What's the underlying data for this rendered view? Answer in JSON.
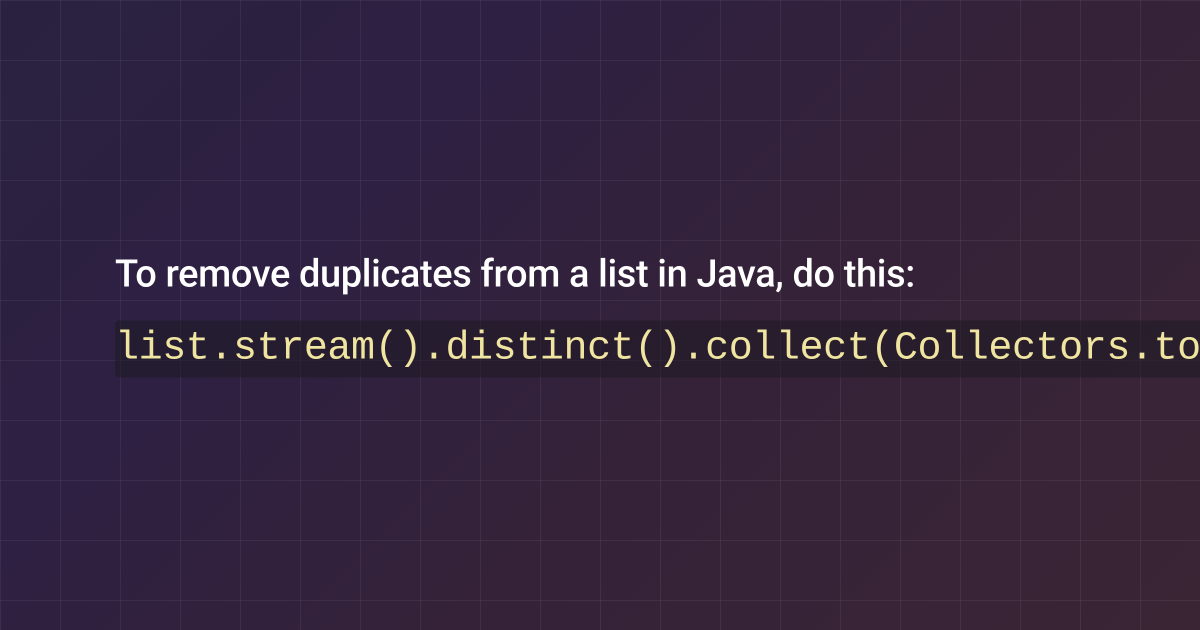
{
  "content": {
    "heading": "To remove duplicates from a list in Java, do this:",
    "code": "list.stream().distinct().collect(Collectors.toList())"
  }
}
